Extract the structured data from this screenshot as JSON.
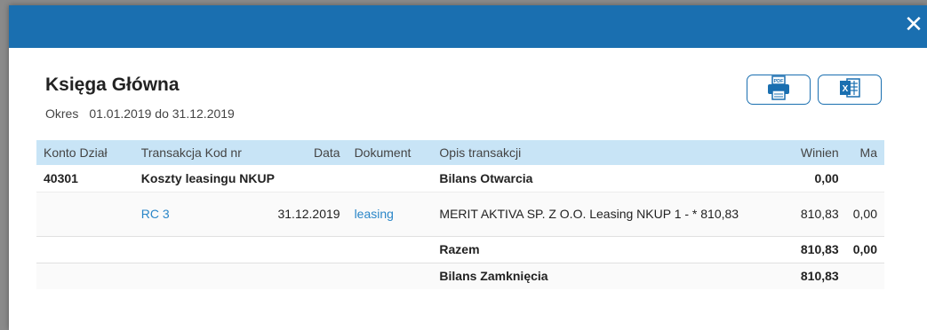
{
  "header": {
    "close_glyph": "✕"
  },
  "title": "Księga Główna",
  "period": {
    "label": "Okres",
    "value": "01.01.2019 do 31.12.2019"
  },
  "export": {
    "pdf_icon": "pdf-printer-icon",
    "xls_icon": "excel-icon"
  },
  "table": {
    "headers": [
      "Konto Dział",
      "Transakcja Kod nr",
      "Data",
      "Dokument",
      "Opis transakcji",
      "Winien",
      "Ma"
    ],
    "account_row": {
      "account": "40301",
      "name": "Koszty leasingu NKUP",
      "opening_label": "Bilans Otwarcia",
      "winien": "0,00",
      "ma": ""
    },
    "transaction": {
      "code": "RC 3",
      "date": "31.12.2019",
      "document": "leasing",
      "description": "MERIT AKTIVA SP. Z O.O. Leasing NKUP 1 - * 810,83",
      "winien": "810,83",
      "ma": "0,00"
    },
    "total_row": {
      "label": "Razem",
      "winien": "810,83",
      "ma": "0,00"
    },
    "closing_row": {
      "label": "Bilans Zamknięcia",
      "winien": "810,83"
    }
  },
  "colors": {
    "header_blue": "#1a6fb0",
    "table_header_bg": "#c8e4f6",
    "link": "#2a86c8"
  }
}
